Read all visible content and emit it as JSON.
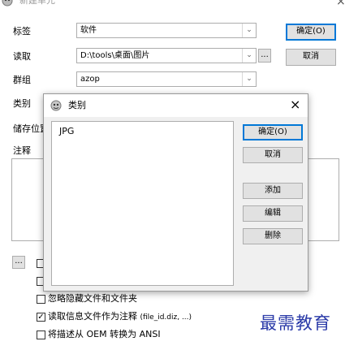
{
  "main_window": {
    "title": "新建单元",
    "close_glyph": "×",
    "fields": {
      "tag_label": "标签",
      "tag_value": "软件",
      "read_label": "读取",
      "read_value": "D:\\tools\\桌面\\图片",
      "browse_label": "...",
      "group_label": "群组",
      "group_value": "azop",
      "category_label": "类别",
      "storage_label": "储存位置",
      "comment_label": "注释"
    },
    "buttons": {
      "ok": "确定(O)",
      "cancel": "取消",
      "more": "..."
    },
    "options": [
      {
        "label": "",
        "checked": false
      },
      {
        "label": "",
        "checked": false
      },
      {
        "label": "忽略隐藏文件和文件夹",
        "checked": false
      },
      {
        "label": "读取信息文件作为注释",
        "extra": "(file_id.diz, ...)",
        "checked": true
      },
      {
        "label": "将描述从 OEM 转换为 ANSI",
        "checked": false
      }
    ]
  },
  "dialog": {
    "title": "类别",
    "close_glyph": "×",
    "list_items": [
      "JPG"
    ],
    "buttons": {
      "ok": "确定(O)",
      "cancel": "取消",
      "add": "添加",
      "edit": "编辑",
      "delete": "删除"
    }
  },
  "watermark": "最需教育",
  "colors": {
    "accent": "#0078d7",
    "watermark": "#2a3aa8",
    "label_blue": "#1a1aa0"
  }
}
